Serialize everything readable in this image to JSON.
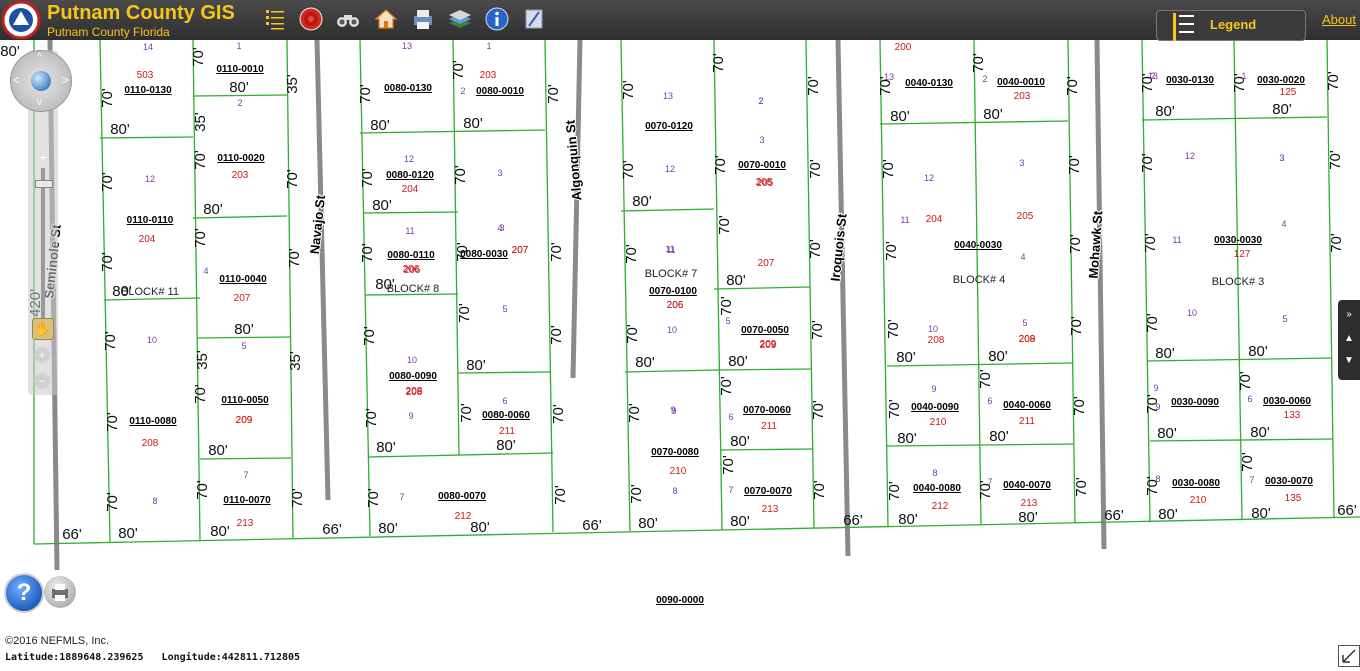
{
  "header": {
    "title": "Putnam County GIS",
    "subtitle": "Putnam County Florida",
    "tools": [
      "layers-list-icon",
      "target-icon",
      "binoculars-icon",
      "home-icon",
      "print-icon",
      "basemap-layers-icon",
      "info-icon",
      "measure-icon"
    ],
    "legend_label": "Legend",
    "about_label": "About"
  },
  "footer": {
    "copyright": "©2016 NEFMLS, Inc.",
    "latitude_label": "Latitude:",
    "latitude_value": "1889648.239625",
    "longitude_label": "Longitude:",
    "longitude_value": "442811.712805"
  },
  "colors": {
    "accent": "#f6c619",
    "parcel_line": "#2fae2f",
    "parcel_id": "#000000",
    "lot_number": "#7a3aa8",
    "address": "#d01818",
    "road": "#8a8a8a"
  },
  "streets": [
    {
      "name": "Seminole St"
    },
    {
      "name": "Navajo St"
    },
    {
      "name": "Algonquin St"
    },
    {
      "name": "Iroquois St"
    },
    {
      "name": "Mohawk St"
    }
  ],
  "blocks": [
    "BLOCK# 11",
    "BLOCK# 8",
    "BLOCK# 7",
    "BLOCK# 4",
    "BLOCK# 3"
  ],
  "parcels": [
    {
      "id": "0110-0010",
      "lot": "1"
    },
    {
      "id": "0110-0130",
      "lot": "14",
      "addr": "503"
    },
    {
      "id": "0110-0020",
      "lot": "2",
      "addr": "203"
    },
    {
      "id": "0110-0110",
      "lot": "12",
      "addr": "204"
    },
    {
      "id": "0110-0040",
      "lot": "4",
      "addr": "207"
    },
    {
      "id": "0110-0050",
      "lot": "5",
      "addr": "209"
    },
    {
      "id": "0110-0080",
      "lot": "10",
      "addr": "208"
    },
    {
      "id": "0110-0070",
      "lot": "7",
      "addr": "213"
    },
    {
      "id": "0080-0130",
      "lot": "13"
    },
    {
      "id": "0080-0010",
      "lot": "1",
      "addr": "203"
    },
    {
      "id": "0080-0120",
      "lot": "12",
      "addr": "204"
    },
    {
      "id": "0080-0110",
      "lot": "11",
      "addr": "206"
    },
    {
      "id": "0080-0030",
      "lot": "3",
      "addr": "207"
    },
    {
      "id": "0080-0090",
      "lot": "10",
      "addr": "208"
    },
    {
      "id": "0080-0060",
      "lot": "6",
      "addr": "211"
    },
    {
      "id": "0080-0070",
      "lot": "7",
      "addr": "212"
    },
    {
      "id": "0070-0120",
      "lot": "13"
    },
    {
      "id": "0070-0010",
      "lot": "2",
      "addr": "205"
    },
    {
      "id": "0070-0100",
      "lot": "11",
      "addr": "206"
    },
    {
      "id": "0070-0050",
      "lot": "5",
      "addr": "209"
    },
    {
      "id": "0070-0060",
      "lot": "6",
      "addr": "211"
    },
    {
      "id": "0070-0080",
      "lot": "9",
      "addr": "210"
    },
    {
      "id": "0070-0070",
      "lot": "7",
      "addr": "213"
    },
    {
      "id": "0040-0130",
      "lot": "13",
      "addr": "200"
    },
    {
      "id": "0040-0010",
      "lot": "2",
      "addr": "203"
    },
    {
      "id": "0040-0030",
      "lot": "3",
      "addr": "204"
    },
    {
      "id": "0040-0090",
      "lot": "9",
      "addr": "210"
    },
    {
      "id": "0040-0060",
      "lot": "6",
      "addr": "211"
    },
    {
      "id": "0040-0080",
      "lot": "8",
      "addr": "212"
    },
    {
      "id": "0040-0070",
      "lot": "7",
      "addr": "213"
    },
    {
      "id": "0030-0130",
      "lot": "13"
    },
    {
      "id": "0030-0020",
      "lot": "1",
      "addr": "125"
    },
    {
      "id": "0030-0030",
      "lot": "3",
      "addr": "127"
    },
    {
      "id": "0030-0090",
      "lot": "9"
    },
    {
      "id": "0030-0060",
      "lot": "6",
      "addr": "133"
    },
    {
      "id": "0030-0080",
      "lot": "8",
      "addr": "210"
    },
    {
      "id": "0030-0070",
      "lot": "7",
      "addr": "135"
    },
    {
      "id": "0090-0000"
    }
  ],
  "dimensions": [
    "80'",
    "70'",
    "35'",
    "66'",
    "420'"
  ],
  "extra_numbers": [
    "12",
    "11",
    "10",
    "9",
    "8",
    "5",
    "4",
    "3",
    "2",
    "205",
    "206",
    "207",
    "208",
    "209"
  ]
}
